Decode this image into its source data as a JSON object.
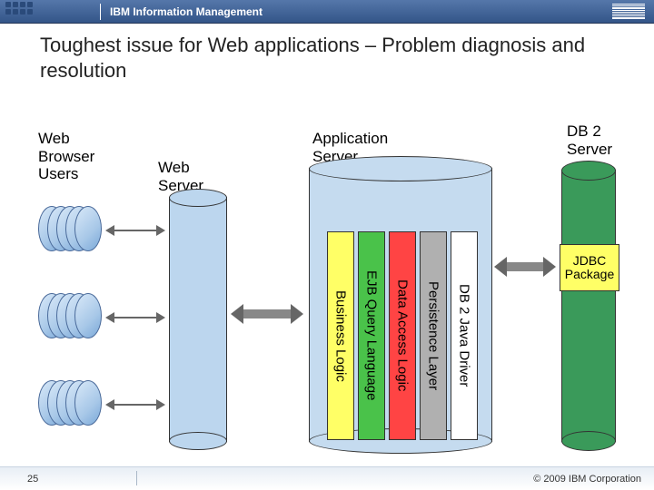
{
  "header": {
    "brand": "IBM Information Management"
  },
  "title": "Toughest issue for Web applications – Problem diagnosis and resolution",
  "labels": {
    "web_browser_users": "Web Browser Users",
    "web_server": "Web Server",
    "application_server": "Application Server",
    "db2_server": "DB 2 Server"
  },
  "columns": {
    "business_logic": "Business Logic",
    "ejb_ql": "EJB Query Language",
    "data_access": "Data Access Logic",
    "persistence": "Persistence Layer",
    "driver": "DB 2 Java Driver"
  },
  "jdbc": "JDBC Package",
  "footer": {
    "page": "25",
    "copyright": "© 2009 IBM Corporation"
  }
}
